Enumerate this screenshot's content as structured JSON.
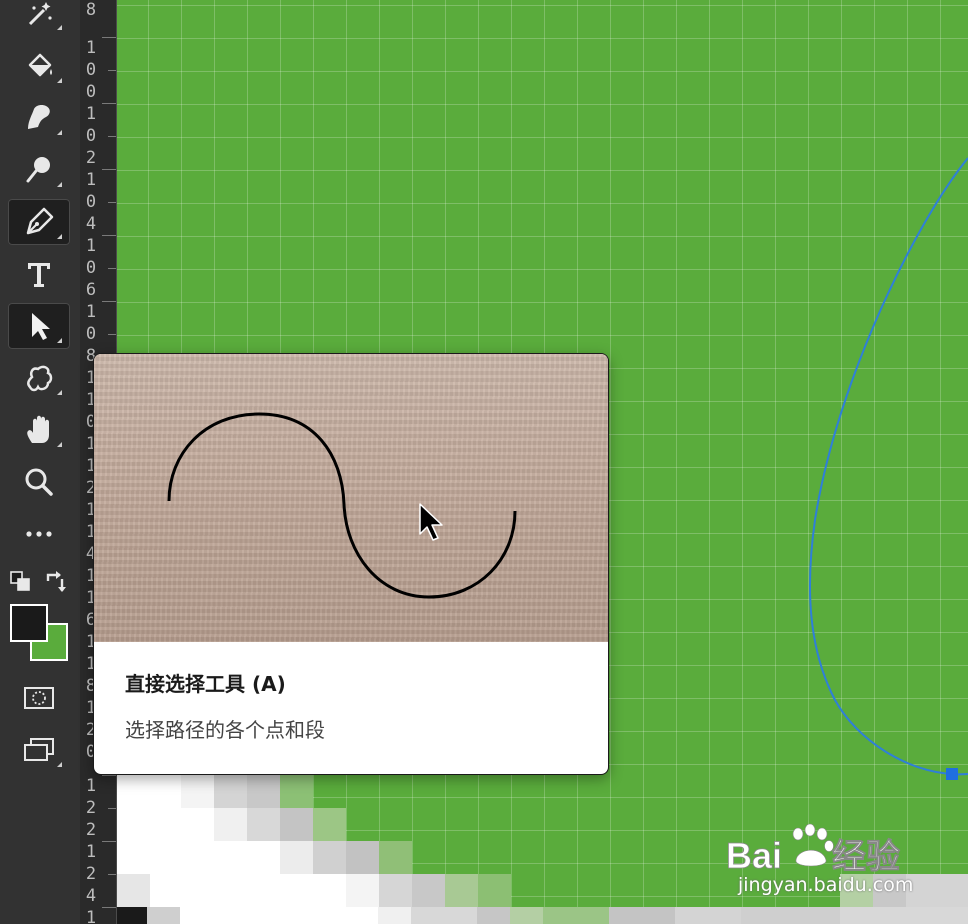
{
  "toolbar": {
    "tools": [
      {
        "name": "magic-wand-icon",
        "active": false
      },
      {
        "name": "paint-bucket-icon",
        "active": false
      },
      {
        "name": "smudge-icon",
        "active": false
      },
      {
        "name": "dodge-icon",
        "active": false
      },
      {
        "name": "pen-icon",
        "active": true
      },
      {
        "name": "type-icon",
        "active": false
      },
      {
        "name": "direct-selection-icon",
        "active": true
      },
      {
        "name": "custom-shape-icon",
        "active": false
      },
      {
        "name": "hand-icon",
        "active": false
      },
      {
        "name": "zoom-icon",
        "active": false
      },
      {
        "name": "more-tools-icon",
        "active": false
      }
    ],
    "foreground_color": "#1a1a1a",
    "background_color": "#5aac3c"
  },
  "ruler": {
    "labels": [
      "8",
      "100",
      "102",
      "104",
      "106",
      "108",
      "110",
      "112",
      "114",
      "116",
      "118",
      "120",
      "122",
      "124",
      "1"
    ]
  },
  "tooltip": {
    "title": "直接选择工具 (A)",
    "description": "选择路径的各个点和段"
  },
  "watermark": {
    "brand": "Bai du 经验",
    "url": "jingyan.baidu.com"
  },
  "colors": {
    "canvas": "#5aac3c",
    "path": "#2f7fd8",
    "toolbar": "#323232"
  }
}
